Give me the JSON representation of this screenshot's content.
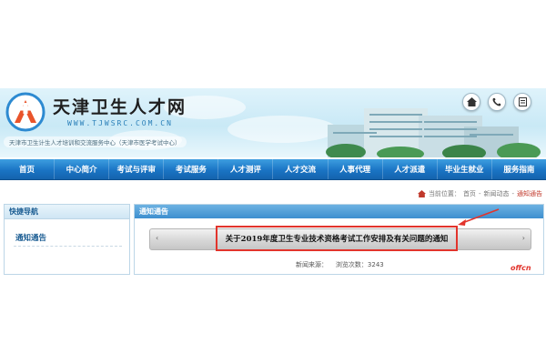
{
  "header": {
    "site_title": "天津卫生人才网",
    "site_url": "WWW.TJWSRC.COM.CN",
    "slogan": "天津市卫生计生人才培训和交流服务中心（天津市医学考试中心）",
    "quick_icons": [
      "home-icon",
      "phone-icon",
      "document-icon"
    ]
  },
  "nav": {
    "items": [
      "首页",
      "中心简介",
      "考试与评审",
      "考试服务",
      "人才测评",
      "人才交流",
      "人事代理",
      "人才派遣",
      "毕业生就业",
      "服务指南"
    ]
  },
  "breadcrumb": {
    "prefix": "当前位置：",
    "home": "首页",
    "sep1": "-",
    "section": "新闻动态",
    "sep2": "-",
    "current": "通知通告"
  },
  "sidebar": {
    "heading": "快捷导航",
    "item": "通知通告"
  },
  "main": {
    "heading": "通知通告",
    "article_title": "关于2019年度卫生专业技术资格考试工作安排及有关问题的通知",
    "source_label": "新闻来源：",
    "views_label": "浏览次数：",
    "views_value": "3243"
  },
  "watermark": "offcn",
  "colors": {
    "nav_bg": "#1a74c4",
    "highlight_border": "#e2342c",
    "breadcrumb_current": "#c0392b"
  }
}
